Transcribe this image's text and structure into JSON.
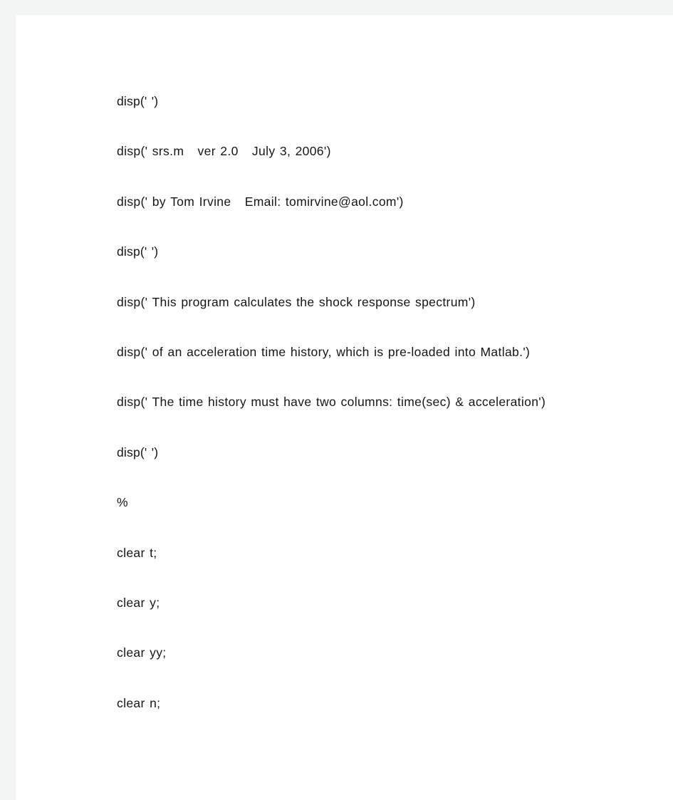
{
  "document": {
    "page_background": "#f3f4f4",
    "sheet_background": "#ffffff",
    "text_color": "#161616",
    "language": "matlab",
    "script_name": "srs.m"
  },
  "code": {
    "lines": [
      {
        "index": 0,
        "text": "disp(' ')"
      },
      {
        "index": 1,
        "text": "disp(' srs.m   ver 2.0   July 3, 2006')"
      },
      {
        "index": 2,
        "text": "disp(' by Tom Irvine   Email: tomirvine@aol.com')"
      },
      {
        "index": 3,
        "text": "disp(' ')"
      },
      {
        "index": 4,
        "text": "disp(' This program calculates the shock response spectrum')"
      },
      {
        "index": 5,
        "text": "disp(' of an acceleration time history, which is pre-loaded into Matlab.')"
      },
      {
        "index": 6,
        "text": "disp(' The time history must have two columns: time(sec) & acceleration')"
      },
      {
        "index": 7,
        "text": "disp(' ')"
      },
      {
        "index": 8,
        "text": "%"
      },
      {
        "index": 9,
        "text": "clear t;"
      },
      {
        "index": 10,
        "text": "clear y;"
      },
      {
        "index": 11,
        "text": "clear yy;"
      },
      {
        "index": 12,
        "text": "clear n;"
      }
    ]
  }
}
